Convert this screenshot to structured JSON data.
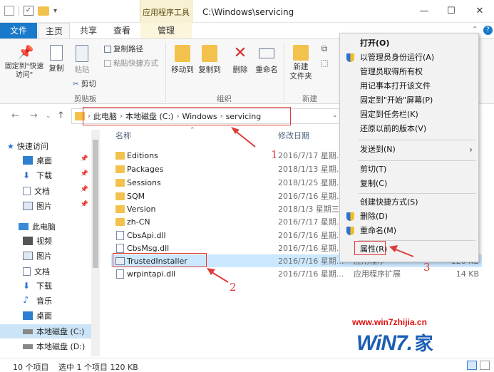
{
  "title_bar": {
    "context_tab_title": "应用程序工具",
    "path_title": "C:\\Windows\\servicing",
    "minimize": "—",
    "maximize": "☐",
    "close": "✕"
  },
  "tabs": [
    "文件",
    "主页",
    "共享",
    "查看",
    "管理"
  ],
  "ribbon": {
    "pin_quick_access": "固定到\"快速访问\"",
    "copy": "复制",
    "paste": "粘贴",
    "copy_path": "复制路径",
    "paste_shortcut": "粘贴快捷方式",
    "cut": "剪切",
    "clipboard_group": "剪贴板",
    "move_to": "移动到",
    "copy_to": "复制到",
    "delete": "删除",
    "rename": "重命名",
    "organize_group": "组织",
    "new_folder": "新建\n文件夹",
    "new_group": "新建"
  },
  "address": {
    "segments": [
      "此电脑",
      "本地磁盘 (C:)",
      "Windows",
      "servicing"
    ]
  },
  "sidebar": {
    "items": [
      {
        "label": "快速访问",
        "icon": "star-icon"
      },
      {
        "label": "桌面",
        "icon": "desktop-icon",
        "pinned": true
      },
      {
        "label": "下载",
        "icon": "download-icon",
        "pinned": true
      },
      {
        "label": "文档",
        "icon": "document-icon",
        "pinned": true
      },
      {
        "label": "图片",
        "icon": "picture-icon",
        "pinned": true
      },
      {
        "label": "此电脑",
        "icon": "computer-icon"
      },
      {
        "label": "视频",
        "icon": "video-icon"
      },
      {
        "label": "图片",
        "icon": "picture-icon"
      },
      {
        "label": "文档",
        "icon": "document-icon"
      },
      {
        "label": "下载",
        "icon": "download-icon"
      },
      {
        "label": "音乐",
        "icon": "music-icon"
      },
      {
        "label": "桌面",
        "icon": "desktop-icon"
      },
      {
        "label": "本地磁盘 (C:)",
        "icon": "drive-icon",
        "selected": true
      },
      {
        "label": "本地磁盘 (D:)",
        "icon": "drive-icon"
      }
    ]
  },
  "file_list": {
    "columns": {
      "name": "名称",
      "date": "修改日期"
    },
    "rows": [
      {
        "name": "Editions",
        "date": "2016/7/17 星期...",
        "type": "",
        "size": "",
        "kind": "folder"
      },
      {
        "name": "Packages",
        "date": "2018/1/13 星期...",
        "type": "",
        "size": "",
        "kind": "folder"
      },
      {
        "name": "Sessions",
        "date": "2018/1/25 星期...",
        "type": "",
        "size": "",
        "kind": "folder"
      },
      {
        "name": "SQM",
        "date": "2016/7/16 星期...",
        "type": "",
        "size": "",
        "kind": "folder"
      },
      {
        "name": "Version",
        "date": "2018/1/3 星期三",
        "type": "",
        "size": "",
        "kind": "folder"
      },
      {
        "name": "zh-CN",
        "date": "2016/7/17 星期...",
        "type": "",
        "size": "",
        "kind": "folder"
      },
      {
        "name": "CbsApi.dll",
        "date": "2016/7/16 星期...",
        "type": "",
        "size": "",
        "kind": "dll"
      },
      {
        "name": "CbsMsg.dll",
        "date": "2016/7/16 星期...",
        "type": "",
        "size": "",
        "kind": "dll"
      },
      {
        "name": "TrustedInstaller",
        "date": "2016/7/16 星期...",
        "type": "应用程序",
        "size": "120 KB",
        "kind": "exe",
        "selected": true
      },
      {
        "name": "wrpintapi.dll",
        "date": "2016/7/16 星期...",
        "type": "应用程序扩展",
        "size": "14 KB",
        "kind": "dll"
      }
    ]
  },
  "status_bar": {
    "count": "10 个项目",
    "selection": "选中 1 个项目  120 KB"
  },
  "context_menu": {
    "items": [
      {
        "label": "打开(O)",
        "bold": true
      },
      {
        "label": "以管理员身份运行(A)",
        "shield": true
      },
      {
        "label": "管理员取得所有权"
      },
      {
        "label": "用记事本打开该文件"
      },
      {
        "label": "固定到\"开始\"屏幕(P)"
      },
      {
        "label": "固定到任务栏(K)"
      },
      {
        "label": "还原以前的版本(V)"
      },
      {
        "label": "发送到(N)",
        "submenu": true
      },
      {
        "label": "剪切(T)"
      },
      {
        "label": "复制(C)"
      },
      {
        "label": "创建快捷方式(S)"
      },
      {
        "label": "删除(D)",
        "shield": true
      },
      {
        "label": "重命名(M)",
        "shield": true
      },
      {
        "label": "属性(R)"
      }
    ]
  },
  "annotations": {
    "step1": "1",
    "step2": "2",
    "step3": "3",
    "color": "#e03a3a"
  },
  "watermark": {
    "url": "www.win7zhijia.cn",
    "logo_text": "WiN7.",
    "logo_suffix": "家"
  }
}
